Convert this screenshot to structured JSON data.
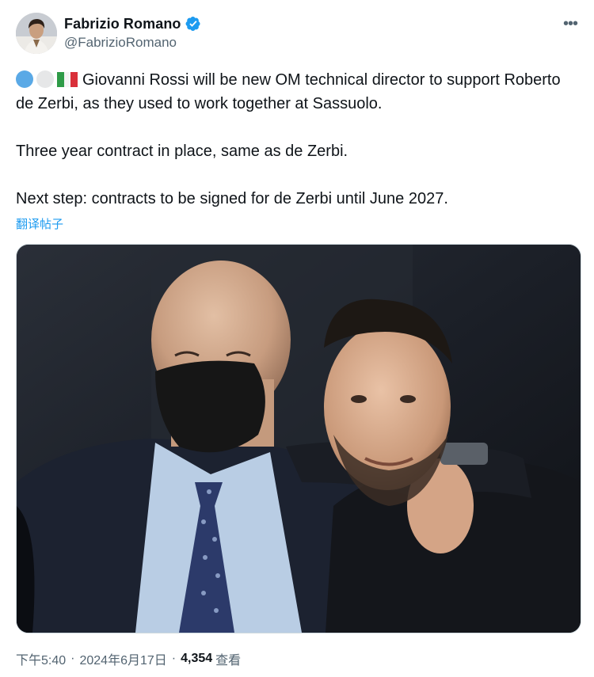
{
  "author": {
    "display_name": "Fabrizio Romano",
    "handle": "@FabrizioRomano",
    "verified": true
  },
  "tweet": {
    "emojis": [
      "blue-circle-emoji",
      "white-circle-emoji",
      "italy-flag-emoji"
    ],
    "paragraphs": [
      "Giovanni Rossi will be new OM technical director to support Roberto de Zerbi, as they used to work together at Sassuolo.",
      "Three year contract in place, same as de Zerbi.",
      "Next step: contracts to be signed for de Zerbi until June 2027."
    ],
    "translate_label": "翻译帖子"
  },
  "footer": {
    "time": "下午5:40",
    "separator": "·",
    "date": "2024年6月17日",
    "views_count": "4,354",
    "views_label": "查看"
  },
  "colors": {
    "link": "#1d9bf0",
    "secondary": "#536471",
    "text": "#0f1419"
  }
}
